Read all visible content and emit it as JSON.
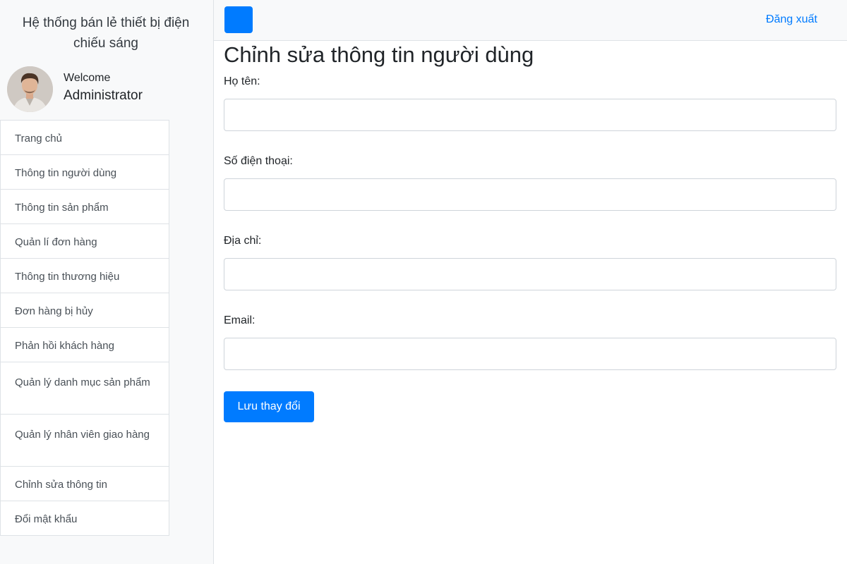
{
  "sidebar": {
    "brand": "Hệ thống bán lẻ thiết bị điện chiếu sáng",
    "welcome": "Welcome",
    "user_name": "Administrator",
    "menu": [
      {
        "label": "Trang chủ"
      },
      {
        "label": "Thông tin người dùng"
      },
      {
        "label": "Thông tin sản phẩm"
      },
      {
        "label": "Quản lí đơn hàng"
      },
      {
        "label": "Thông tin thương hiệu"
      },
      {
        "label": "Đơn hàng bị hủy"
      },
      {
        "label": "Phản hồi khách hàng"
      },
      {
        "label": "Quản lý danh mục sản phẩm"
      },
      {
        "label": "Quản lý nhân viên giao hàng"
      },
      {
        "label": "Chỉnh sửa thông tin"
      },
      {
        "label": "Đổi mật khẩu"
      }
    ]
  },
  "navbar": {
    "logout": "Đăng xuất"
  },
  "form": {
    "title": "Chỉnh sửa thông tin người dùng",
    "fields": {
      "name": {
        "label": "Họ tên:",
        "value": ""
      },
      "phone": {
        "label": "Số điện thoại:",
        "value": ""
      },
      "address": {
        "label": "Địa chỉ:",
        "value": ""
      },
      "email": {
        "label": "Email:",
        "value": ""
      }
    },
    "submit": "Lưu thay đổi"
  },
  "colors": {
    "primary": "#007bff",
    "sidebar_bg": "#f8f9fa",
    "border": "#dee2e6"
  }
}
